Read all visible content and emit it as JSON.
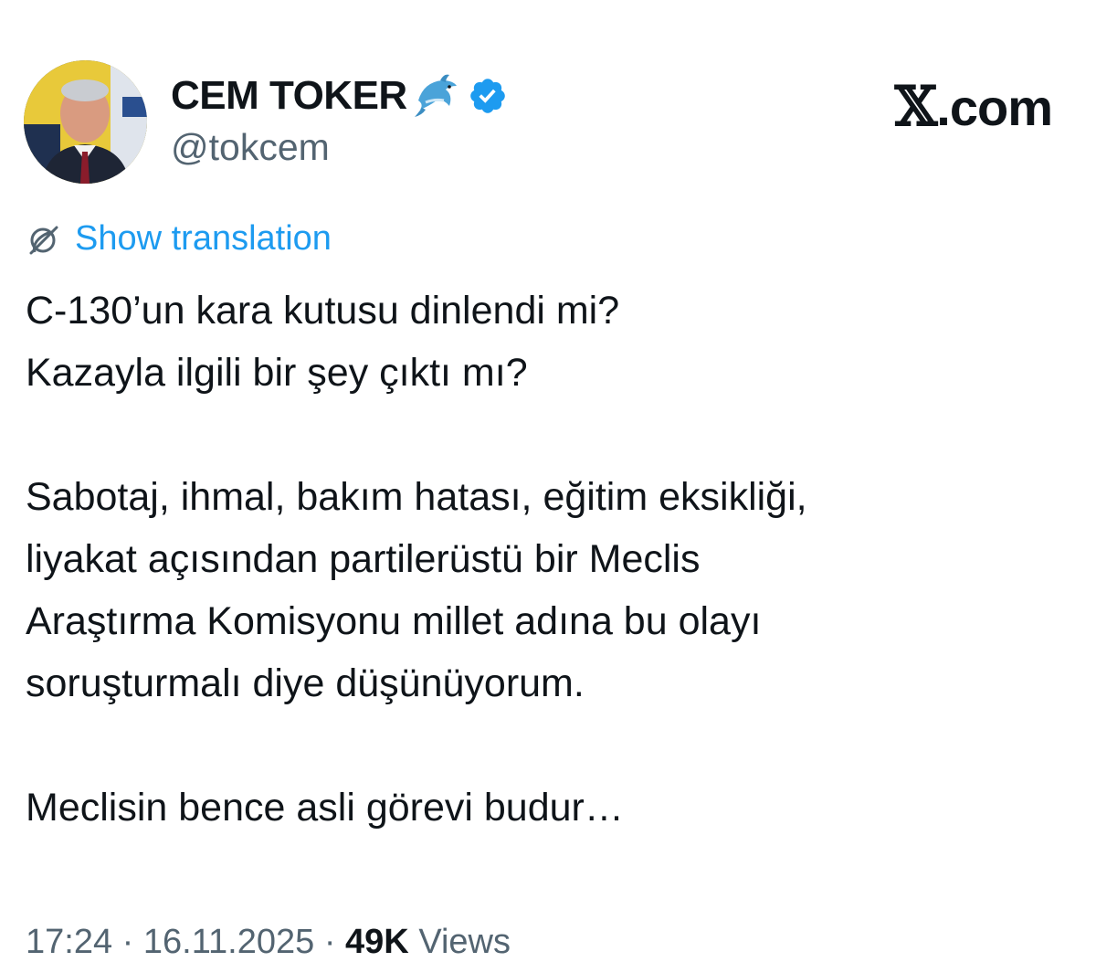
{
  "author": {
    "display_name": "CEM TOKER",
    "handle": "@tokcem",
    "emoji": "🐬",
    "verified_icon": "verified-badge-icon",
    "avatar_icon": "profile-photo"
  },
  "brand": {
    "x_mark": "𝕏",
    "domain": ".com"
  },
  "translation": {
    "icon": "translate-globe-icon",
    "label": "Show translation"
  },
  "tweet": {
    "lines": [
      "C-130’un kara kutusu dinlendi mi?",
      "Kazayla ilgili bir şey çıktı mı?",
      "",
      "Sabotaj, ihmal, bakım hatası, eğitim eksikliği,",
      "liyakat açısından partilerüstü bir Meclis",
      "Araştırma Komisyonu millet adına bu olayı",
      "soruşturmalı diye düşünüyorum.",
      "",
      "Meclisin bence asli görevi budur…"
    ]
  },
  "meta": {
    "time": "17:24",
    "separator": "·",
    "date": "16.11.2025",
    "views_count": "49K",
    "views_label": "Views"
  },
  "colors": {
    "accent": "#1d9bf0",
    "text": "#0f1419",
    "muted": "#536471"
  }
}
